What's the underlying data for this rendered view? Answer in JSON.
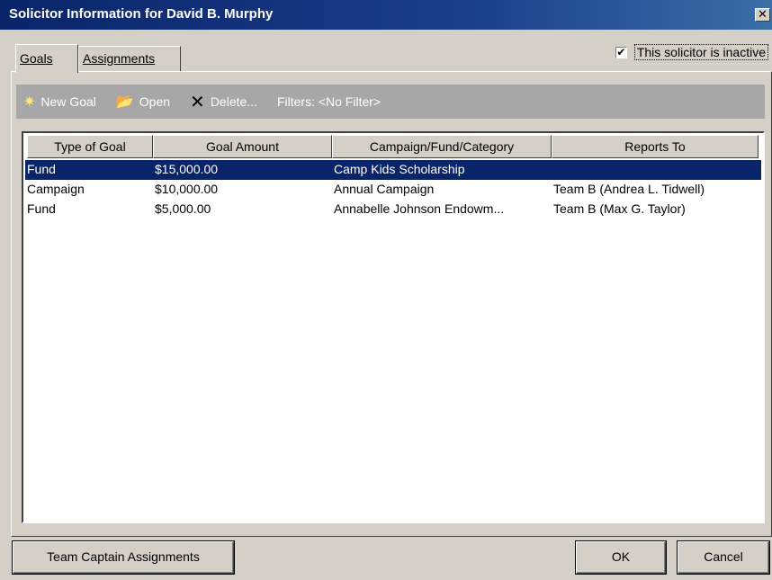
{
  "window": {
    "title": "Solicitor Information for David B. Murphy",
    "close_symbol": "✕"
  },
  "tabs": [
    {
      "label": "Goals",
      "active": true
    },
    {
      "label": "Assignments",
      "active": false
    }
  ],
  "inactive_checkbox": {
    "label": "This solicitor is inactive",
    "checked": true,
    "check_symbol": "✔"
  },
  "toolbar": {
    "new_goal_label": "New Goal",
    "open_label": "Open",
    "delete_label": "Delete...",
    "filter_label": "Filters: <No Filter>",
    "new_goal_icon": "✷",
    "open_icon": "📂",
    "delete_icon": "✕"
  },
  "grid": {
    "columns": [
      "Type of Goal",
      "Goal Amount",
      "Campaign/Fund/Category",
      "Reports To"
    ],
    "rows": [
      {
        "type": "Fund",
        "amount": "$15,000.00",
        "campaign": "Camp Kids Scholarship",
        "reports_to": "",
        "selected": true
      },
      {
        "type": "Campaign",
        "amount": "$10,000.00",
        "campaign": "Annual Campaign",
        "reports_to": "Team B (Andrea L. Tidwell)",
        "selected": false
      },
      {
        "type": "Fund",
        "amount": "$5,000.00",
        "campaign": "Annabelle Johnson Endowm...",
        "reports_to": "Team B (Max G. Taylor)",
        "selected": false
      }
    ]
  },
  "buttons": {
    "team_captain": "Team Captain Assignments",
    "ok": "OK",
    "cancel": "Cancel"
  },
  "colors": {
    "title_bar": "#0a246a",
    "selection": "#0a246a",
    "toolbar_bg": "#a7a7a7",
    "dialog_bg": "#d4d0c8"
  }
}
